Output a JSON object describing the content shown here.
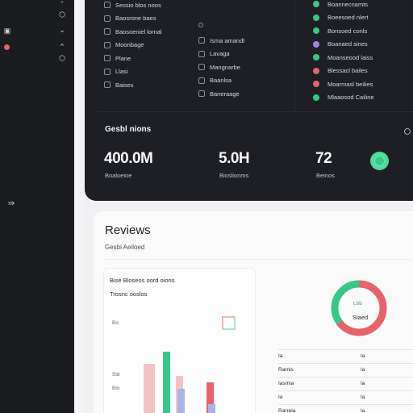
{
  "colors": {
    "sidebar_bg": "#1b1c20",
    "card_dark": "#1e1f24",
    "accent_green": "#36c887",
    "accent_red": "#e6636a",
    "accent_purple": "#9a86e8",
    "bar_blue": "#a9b4e8",
    "bar_pink": "#f3c3c4"
  },
  "sidebar": {
    "icons": [
      "shield-icon",
      "chevron-down-icon",
      "window-icon",
      "forward-arrows-icon"
    ]
  },
  "left_list": [
    "Sessio blos noos",
    "Baosrone baes",
    "Baosoeniel lornal",
    "Moonbage",
    "Plane",
    "Llasi",
    "Baises"
  ],
  "middle_list": [
    "Isma amandl",
    "Lavaga",
    "Mangnarbe",
    "Baanlsa",
    "Baneraage"
  ],
  "right_list": [
    {
      "label": "Boannecnamts",
      "color": "#36c887"
    },
    {
      "label": "Boeesoed nlert",
      "color": "#36c887"
    },
    {
      "label": "Bonsoed conls",
      "color": "#36c887"
    },
    {
      "label": "Boanaed sines",
      "color": "#9a86e8"
    },
    {
      "label": "Moanseood laiss",
      "color": "#36c887"
    },
    {
      "label": "Blessacl bailes",
      "color": "#e6636a"
    },
    {
      "label": "Moarmasl beilies",
      "color": "#e6636a"
    },
    {
      "label": "Mlaaosod Cailine",
      "color": "#36c887"
    }
  ],
  "stats_section": {
    "title": "Gesbl nions",
    "stats": [
      {
        "value": "400.0M",
        "label": "Boaloeioe"
      },
      {
        "value": "5.0H",
        "label": "Bioslionms"
      },
      {
        "value": "72",
        "label": "Beinos"
      }
    ]
  },
  "reviews": {
    "title": "Reviews",
    "subtitle": "Gesbi Aeiloed"
  },
  "chart_data": {
    "type": "bar",
    "title": "Bise Bloseos oord oions",
    "subtitle": "Trosnc ooslos",
    "y_ticks": [
      "Bo",
      "Sid",
      "Bio"
    ],
    "bars": [
      {
        "value": 8,
        "color": "#f3c3c4"
      },
      {
        "value": 10,
        "color": "#36c887"
      },
      {
        "value": 6,
        "color": "#f3c3c4"
      },
      {
        "value": 4,
        "color": "#a9b4e8"
      },
      {
        "value": 5,
        "color": "#e6636a"
      },
      {
        "value": 1.5,
        "color": "#a9b4e8"
      }
    ]
  },
  "donut": {
    "label_top": "Lbb",
    "label_bottom": "Siaed",
    "segments": [
      {
        "fraction": 0.65,
        "color": "#e6636a"
      },
      {
        "fraction": 0.35,
        "color": "#36c887"
      }
    ]
  },
  "table": {
    "rows": [
      [
        "Ia",
        "Ia"
      ],
      [
        "Rarnis",
        "Ia"
      ],
      [
        "Iasmia",
        "Ia"
      ],
      [
        "Ia",
        "Ia"
      ],
      [
        "Rarreia",
        "Ia"
      ]
    ]
  }
}
